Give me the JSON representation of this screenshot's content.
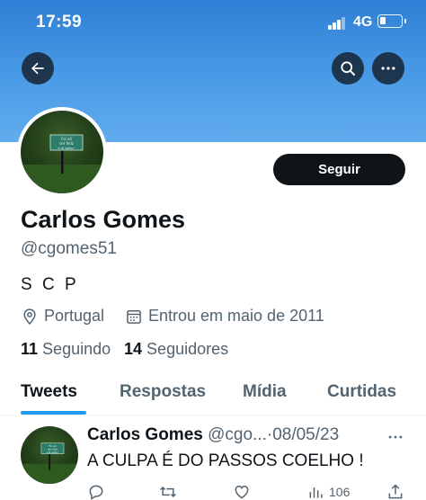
{
  "status_bar": {
    "time": "17:59",
    "network": "4G"
  },
  "header": {
    "back_icon": "arrow-left-icon",
    "search_icon": "search-icon",
    "more_icon": "more-horizontal-icon"
  },
  "profile": {
    "name": "Carlos Gomes",
    "handle": "@cgomes51",
    "bio": "S C P",
    "location": "Portugal",
    "joined": "Entrou em maio de 2011",
    "following_count": "11",
    "following_label": "Seguindo",
    "followers_count": "14",
    "followers_label": "Seguidores",
    "follow_button": "Seguir",
    "avatar_sign_text": "Foi ali\nser feliz\ne já volta !"
  },
  "tabs": [
    {
      "label": "Tweets",
      "active": true
    },
    {
      "label": "Respostas",
      "active": false
    },
    {
      "label": "Mídia",
      "active": false
    },
    {
      "label": "Curtidas",
      "active": false
    }
  ],
  "tweet": {
    "name": "Carlos Gomes",
    "handle": "@cgo...",
    "separator": "·",
    "date": "08/05/23",
    "text": "A CULPA É DO PASSOS COELHO !",
    "views": "106"
  },
  "colors": {
    "accent": "#1d9bf0",
    "banner": "#4a9be6",
    "text": "#0f1419",
    "secondary": "#536471"
  }
}
